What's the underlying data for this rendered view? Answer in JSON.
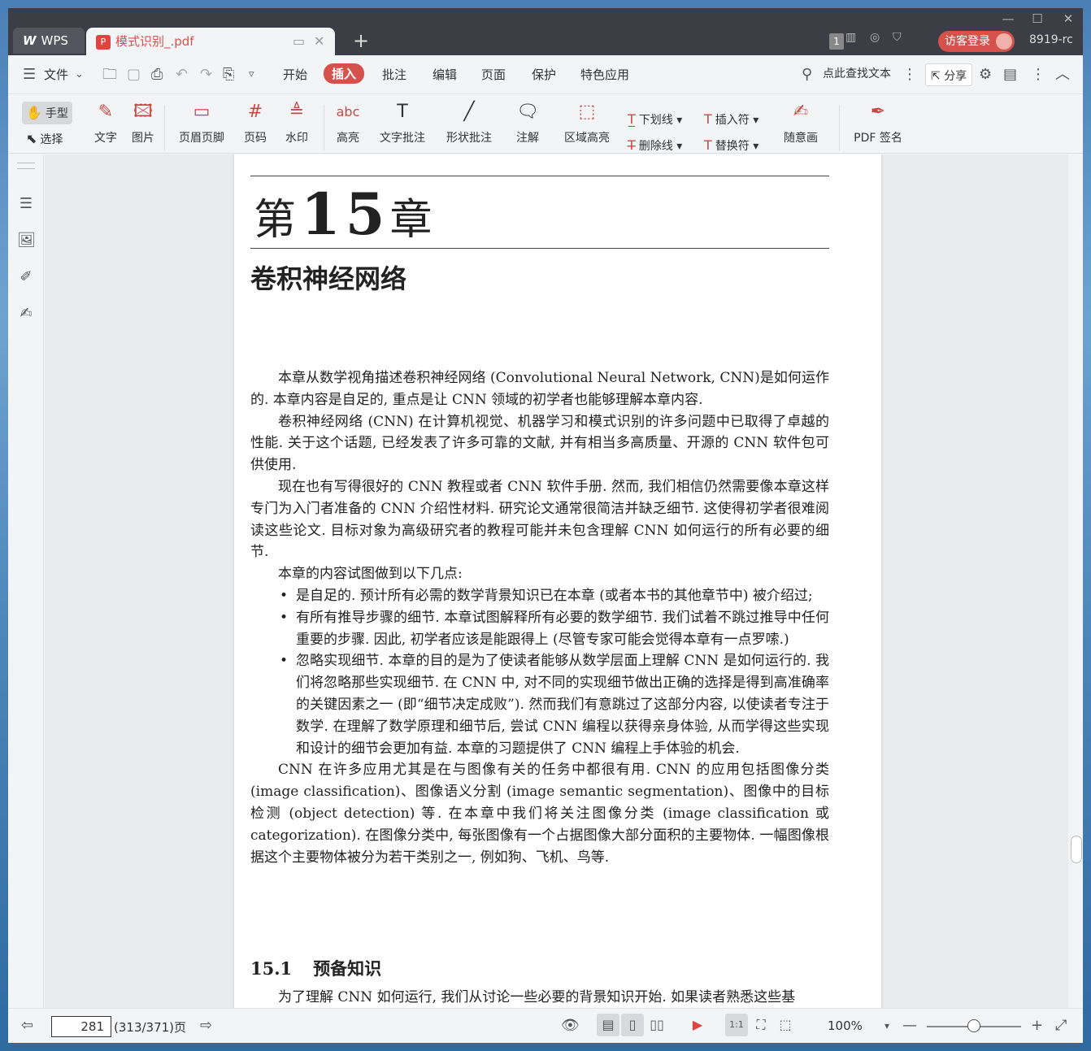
{
  "window": {
    "controls": {
      "minimize": "—",
      "maximize": "☐",
      "close": "✕"
    },
    "tabs": {
      "app": "WPS",
      "app_logo": "W",
      "document": "模式识别_.pdf"
    },
    "user": {
      "page_count_badge": "1",
      "login": "访客登录",
      "name": "8919-rc"
    }
  },
  "menu": {
    "file": "文件",
    "items": [
      "开始",
      "插入",
      "批注",
      "编辑",
      "页面",
      "保护",
      "特色应用"
    ],
    "active": "插入",
    "find": "点此查找文本",
    "share": "分享"
  },
  "toolbar": {
    "hand": "手型",
    "select": "选择",
    "text": "文字",
    "image": "图片",
    "header_footer": "页眉页脚",
    "page_number": "页码",
    "watermark": "水印",
    "highlight": "高亮",
    "text_note": "文字批注",
    "shape_note": "形状批注",
    "annotation": "注解",
    "area_highlight": "区域高亮",
    "underline": "下划线",
    "strikethrough": "删除线",
    "insert_mark": "插入符",
    "replace_mark": "替换符",
    "freehand": "随意画",
    "pdf_sign": "PDF 签名",
    "page_number_icon": "#",
    "highlight_icon": "abc"
  },
  "document": {
    "chapter_prefix": "第",
    "chapter_number": "15",
    "chapter_suffix": "章",
    "chapter_title": "卷积神经网络",
    "paragraphs": [
      "本章从数学视角描述卷积神经网络 (Convolutional Neural Network, CNN)是如何运作的. 本章内容是自足的, 重点是让 CNN 领域的初学者也能够理解本章内容.",
      "卷积神经网络 (CNN) 在计算机视觉、机器学习和模式识别的许多问题中已取得了卓越的性能. 关于这个话题, 已经发表了许多可靠的文献, 并有相当多高质量、开源的 CNN 软件包可供使用.",
      "现在也有写得很好的 CNN 教程或者 CNN 软件手册. 然而, 我们相信仍然需要像本章这样专门为入门者准备的 CNN 介绍性材料. 研究论文通常很简洁并缺乏细节. 这使得初学者很难阅读这些论文. 目标对象为高级研究者的教程可能并未包含理解 CNN 如何运行的所有必要的细节.",
      "本章的内容试图做到以下几点:"
    ],
    "bullets": [
      "是自足的. 预计所有必需的数学背景知识已在本章 (或者本书的其他章节中) 被介绍过;",
      "有所有推导步骤的细节. 本章试图解释所有必要的数学细节. 我们试着不跳过推导中任何重要的步骤. 因此, 初学者应该是能跟得上 (尽管专家可能会觉得本章有一点罗嗦.)",
      "忽略实现细节. 本章的目的是为了使读者能够从数学层面上理解 CNN 是如何运行的. 我们将忽略那些实现细节. 在 CNN 中, 对不同的实现细节做出正确的选择是得到高准确率的关键因素之一 (即“细节决定成败”). 然而我们有意跳过了这部分内容, 以使读者专注于数学. 在理解了数学原理和细节后, 尝试 CNN 编程以获得亲身体验, 从而学得这些实现和设计的细节会更加有益. 本章的习题提供了 CNN 编程上手体验的机会."
    ],
    "closing_paragraph": "CNN 在许多应用尤其是在与图像有关的任务中都很有用. CNN 的应用包括图像分类 (image classification)、图像语义分割 (image semantic segmentation)、图像中的目标检测 (object detection) 等. 在本章中我们将关注图像分类 (image classification 或 categorization). 在图像分类中, 每张图像有一个占据图像大部分面积的主要物体. 一幅图像根据这个主要物体被分为若干类别之一, 例如狗、飞机、鸟等.",
    "section_number": "15.1",
    "section_title": "预备知识",
    "section_first_line": "为了理解 CNN 如何运行, 我们从讨论一些必要的背景知识开始. 如果读者熟悉这些基"
  },
  "status": {
    "page_input": "281",
    "page_total": "(313/371)页",
    "zoom": "100%",
    "zoom_level_fraction": 0.5,
    "zoom_minus": "—",
    "zoom_plus": "+"
  },
  "colors": {
    "accent": "#d4514c",
    "titlebar": "#3c3d45",
    "icon_red": "#c34a46"
  }
}
